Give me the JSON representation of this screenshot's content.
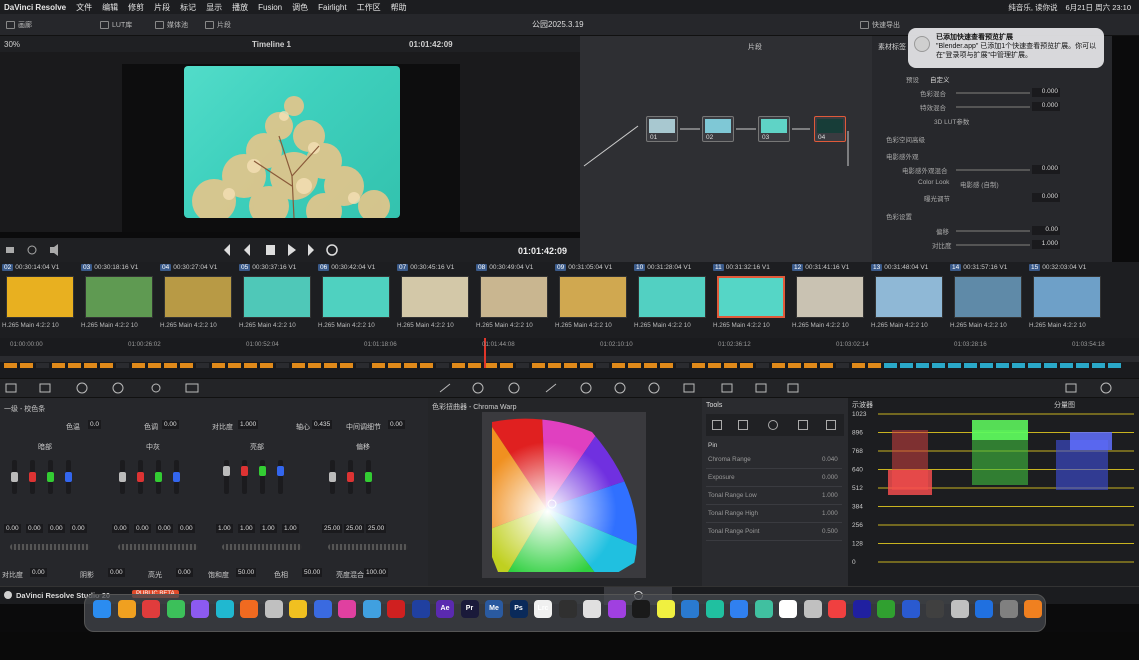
{
  "menubar": {
    "app_name": "DaVinci Resolve",
    "items": [
      "文件",
      "编辑",
      "修剪",
      "片段",
      "标记",
      "显示",
      "播放",
      "Fusion",
      "调色",
      "Fairlight",
      "工作区",
      "帮助"
    ],
    "now_playing": "纯音乐, 读你说",
    "status_date": "6月21日 周六 23:10"
  },
  "toolbar": {
    "media": "画廊",
    "lut": "LUT库",
    "edit": "媒体池",
    "clips": "片段",
    "project_title": "公园2025.3.19",
    "quick_export": "快速导出",
    "lightbox": "光箱"
  },
  "viewer": {
    "zoom": "30%",
    "timeline_name": "Timeline 1",
    "timecode_top": "01:01:42:09",
    "timecode_bottom": "01:01:42:09"
  },
  "nodes": {
    "mode_label": "片段",
    "items": [
      "01",
      "02",
      "03",
      "04"
    ]
  },
  "inspector": {
    "tab": "素材标签",
    "rows": [
      {
        "label": "预设",
        "value": "自定义"
      },
      {
        "label": "色彩混合",
        "value": "0.000"
      },
      {
        "label": "特效混合",
        "value": "0.000"
      },
      {
        "label": "3D LUT参数",
        "value": ""
      },
      {
        "label": "色彩空间高级",
        "value": ""
      },
      {
        "label": "电影感外观",
        "value": ""
      },
      {
        "label": "电影感外观混合",
        "value": "0.000"
      },
      {
        "label": "Color Look",
        "value": "电影感 (自制)"
      },
      {
        "label": "曝光调节",
        "value": "0.000"
      },
      {
        "label": "色彩设置",
        "value": ""
      },
      {
        "label": "偏移",
        "value": "0.00"
      },
      {
        "label": "对比度",
        "value": "1.000"
      }
    ]
  },
  "notification": {
    "title": "已添加快速查看预览扩展",
    "body": "\"Blender.app\" 已添加1个快速查看预览扩展。你可以在\"登录项与扩展\"中管理扩展。"
  },
  "clips": [
    {
      "num": "02",
      "tc": "00:30:14:04",
      "track": "V1",
      "codec": "H.265 Main 4:2:2 10",
      "color": "#e8b020"
    },
    {
      "num": "03",
      "tc": "00:30:18:16",
      "track": "V1",
      "codec": "H.265 Main 4:2:2 10",
      "color": "#5f9a52"
    },
    {
      "num": "04",
      "tc": "00:30:27:04",
      "track": "V1",
      "codec": "H.265 Main 4:2:2 10",
      "color": "#b89a45"
    },
    {
      "num": "05",
      "tc": "00:30:37:16",
      "track": "V1",
      "codec": "H.265 Main 4:2:2 10",
      "color": "#4fc8b8"
    },
    {
      "num": "06",
      "tc": "00:30:42:04",
      "track": "V1",
      "codec": "H.265 Main 4:2:2 10",
      "color": "#4fd1c0"
    },
    {
      "num": "07",
      "tc": "00:30:45:16",
      "track": "V1",
      "codec": "H.265 Main 4:2:2 10",
      "color": "#d3c8a8"
    },
    {
      "num": "08",
      "tc": "00:30:49:04",
      "track": "V1",
      "codec": "H.265 Main 4:2:2 10",
      "color": "#c9b690"
    },
    {
      "num": "09",
      "tc": "00:31:05:04",
      "track": "V1",
      "codec": "H.265 Main 4:2:2 10",
      "color": "#d0a850"
    },
    {
      "num": "10",
      "tc": "00:31:28:04",
      "track": "V1",
      "codec": "H.265 Main 4:2:2 10",
      "color": "#52d0c2"
    },
    {
      "num": "11",
      "tc": "00:31:32:16",
      "track": "V1",
      "codec": "H.265 Main 4:2:2 10",
      "color": "#55d6c6",
      "selected": true
    },
    {
      "num": "12",
      "tc": "00:31:41:16",
      "track": "V1",
      "codec": "H.265 Main 4:2:2 10",
      "color": "#c9c2b2"
    },
    {
      "num": "13",
      "tc": "00:31:48:04",
      "track": "V1",
      "codec": "H.265 Main 4:2:2 10",
      "color": "#8fb8d6"
    },
    {
      "num": "14",
      "tc": "00:31:57:16",
      "track": "V1",
      "codec": "H.265 Main 4:2:2 10",
      "color": "#5f8aa8"
    },
    {
      "num": "15",
      "tc": "00:32:03:04",
      "track": "V1",
      "codec": "H.265 Main 4:2:2 10",
      "color": "#6ea0c8"
    }
  ],
  "ruler_ticks": [
    "01:00:00:00",
    "01:00:26:02",
    "01:00:52:04",
    "01:01:18:06",
    "01:01:44:08",
    "01:02:10:10",
    "01:02:36:12",
    "01:03:02:14",
    "01:03:28:16",
    "01:03:54:18"
  ],
  "wheels": {
    "header": "一级 - 校色条",
    "temp_label": "色温",
    "temp_val": "0.0",
    "tint_label": "色调",
    "tint_val": "0.00",
    "contrast_label": "对比度",
    "contrast_val": "1.000",
    "pivot_label": "轴心",
    "pivot_val": "0.435",
    "middetail_label": "中间调细节",
    "middetail_val": "0.00",
    "groups": [
      {
        "name": "暗部",
        "vals": [
          "0.00",
          "0.00",
          "0.00",
          "0.00"
        ]
      },
      {
        "name": "中灰",
        "vals": [
          "0.00",
          "0.00",
          "0.00",
          "0.00"
        ]
      },
      {
        "name": "亮部",
        "vals": [
          "1.00",
          "1.00",
          "1.00",
          "1.00"
        ]
      },
      {
        "name": "偏移",
        "vals": [
          "25.00",
          "25.00",
          "25.00"
        ]
      }
    ],
    "bottom": [
      {
        "label": "对比度",
        "val": "0.00"
      },
      {
        "label": "阴影",
        "val": "0.00"
      },
      {
        "label": "高光",
        "val": "0.00"
      },
      {
        "label": "饱和度",
        "val": "50.00"
      },
      {
        "label": "色相",
        "val": "50.00"
      },
      {
        "label": "亮度混合",
        "val": "100.00"
      }
    ]
  },
  "warp": {
    "title": "色彩扭曲器 - Chroma Warp"
  },
  "tools": {
    "title": "Tools",
    "pin": "Pin",
    "rows": [
      {
        "label": "Chroma Range",
        "val": "0.040"
      },
      {
        "label": "Exposure",
        "val": "0.000"
      },
      {
        "label": "Tonal Range Low",
        "val": "1.000"
      },
      {
        "label": "Tonal Range High",
        "val": "1.000"
      },
      {
        "label": "Tonal Range Point",
        "val": "0.500"
      }
    ]
  },
  "scope": {
    "title": "示波器",
    "mode": "分量图",
    "ticks": [
      "1023",
      "896",
      "768",
      "640",
      "512",
      "384",
      "256",
      "128",
      "0"
    ]
  },
  "status": {
    "app": "DaVinci Resolve Studio 20",
    "badge": "PUBLIC BETA"
  },
  "dock": [
    "Ae",
    "Pr",
    "Me",
    "Ps",
    "Lrc"
  ],
  "colors": {
    "accent": "#e05a3a",
    "teal": "#4fd1c0",
    "badge": "#e04a2a"
  }
}
